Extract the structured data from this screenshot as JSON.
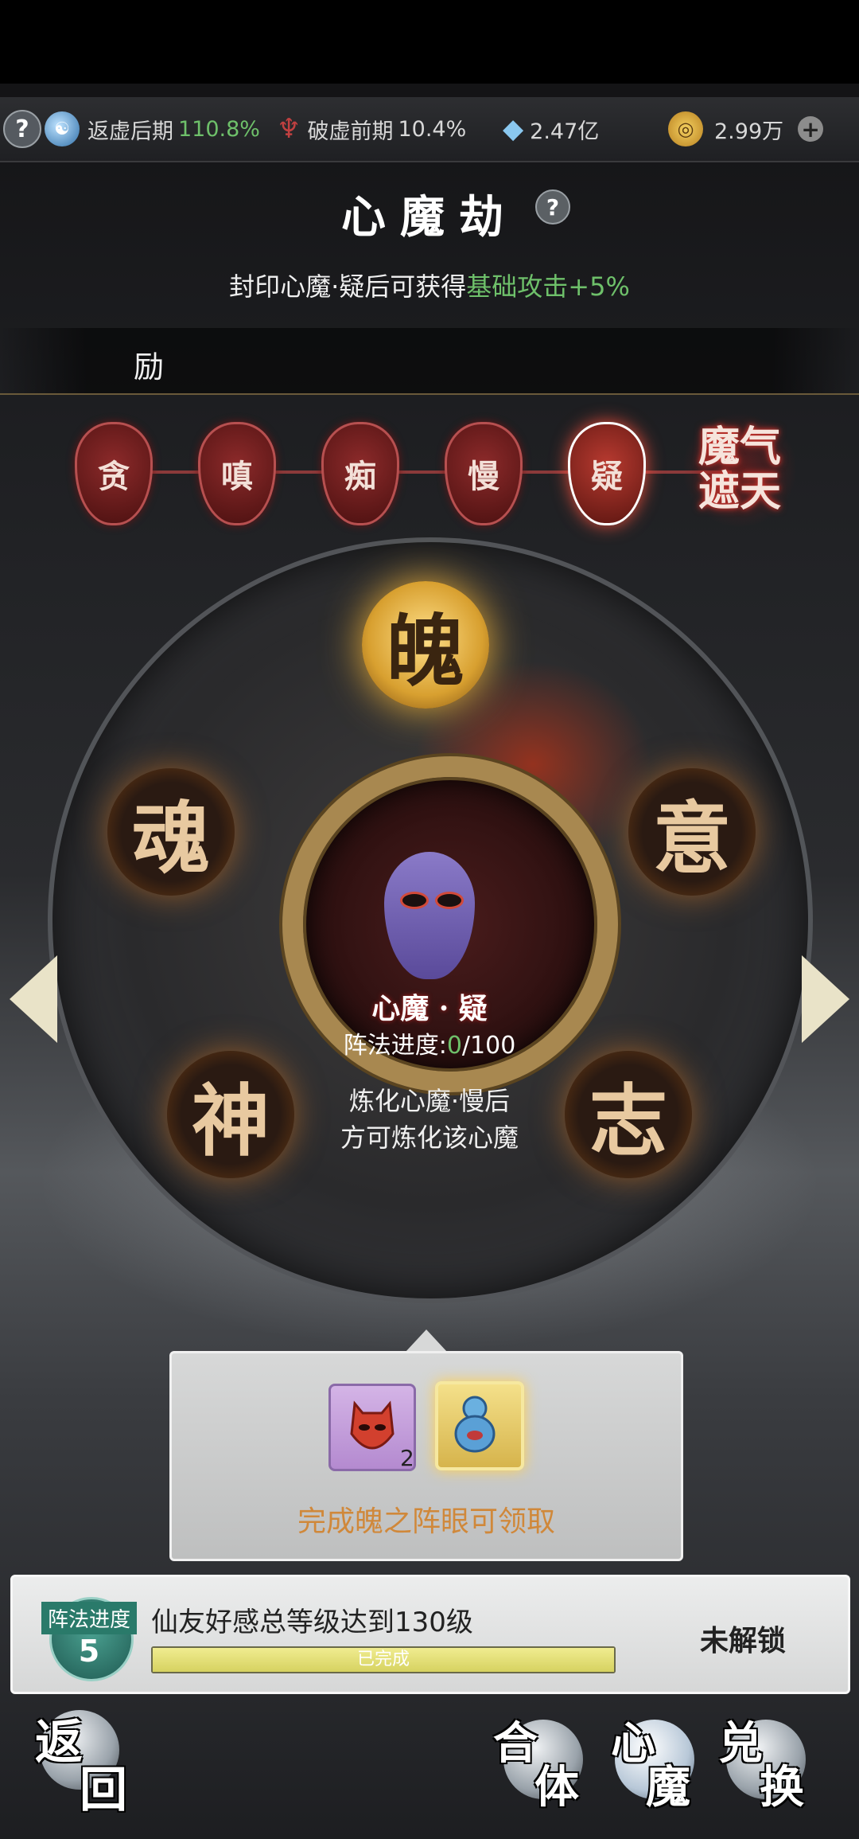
{
  "resources": {
    "help_icon": "?",
    "cultivation": {
      "icon": "yin-yang-icon",
      "label": "返虚后期",
      "value": "110.8%"
    },
    "breakthrough": {
      "icon": "blade-icon",
      "label": "破虚前期",
      "value": "10.4%"
    },
    "spirit_stone": {
      "icon": "crystal-icon",
      "value": "2.47亿"
    },
    "coin": {
      "icon": "coin-icon",
      "value": "2.99万"
    },
    "plus": "+"
  },
  "header": {
    "title": "心魔劫",
    "help": "?",
    "subtitle_prefix": "封印心魔·疑后可获得",
    "subtitle_bonus": "基础攻击+5%"
  },
  "reward_bar_text": "励",
  "stages": [
    {
      "char": "贪"
    },
    {
      "char": "嗔"
    },
    {
      "char": "痴"
    },
    {
      "char": "慢"
    },
    {
      "char": "疑"
    }
  ],
  "final_stage": {
    "line1": "魔气",
    "line2": "遮天"
  },
  "nodes": {
    "top": "魄",
    "left_upper": "魂",
    "right_upper": "意",
    "left_lower": "神",
    "right_lower": "志"
  },
  "center": {
    "title": "心魔 · 疑",
    "progress_label": "阵法进度:",
    "progress_value": "0",
    "progress_total": "/100",
    "desc_line1": "炼化心魔·慢后",
    "desc_line2": "方可炼化该心魔"
  },
  "popup": {
    "item1_count": "2",
    "text": "完成魄之阵眼可领取"
  },
  "task": {
    "badge_label": "阵法进度",
    "badge_num": "5",
    "text": "仙友好感总等级达到130级",
    "bar_label": "已完成",
    "bar_fill_fraction": 1.0,
    "status": "未解锁"
  },
  "nav": {
    "back_1": "返",
    "back_2": "回",
    "combine_1": "合",
    "combine_2": "体",
    "heart_1": "心",
    "heart_2": "魔",
    "exchange_1": "兑",
    "exchange_2": "换"
  }
}
